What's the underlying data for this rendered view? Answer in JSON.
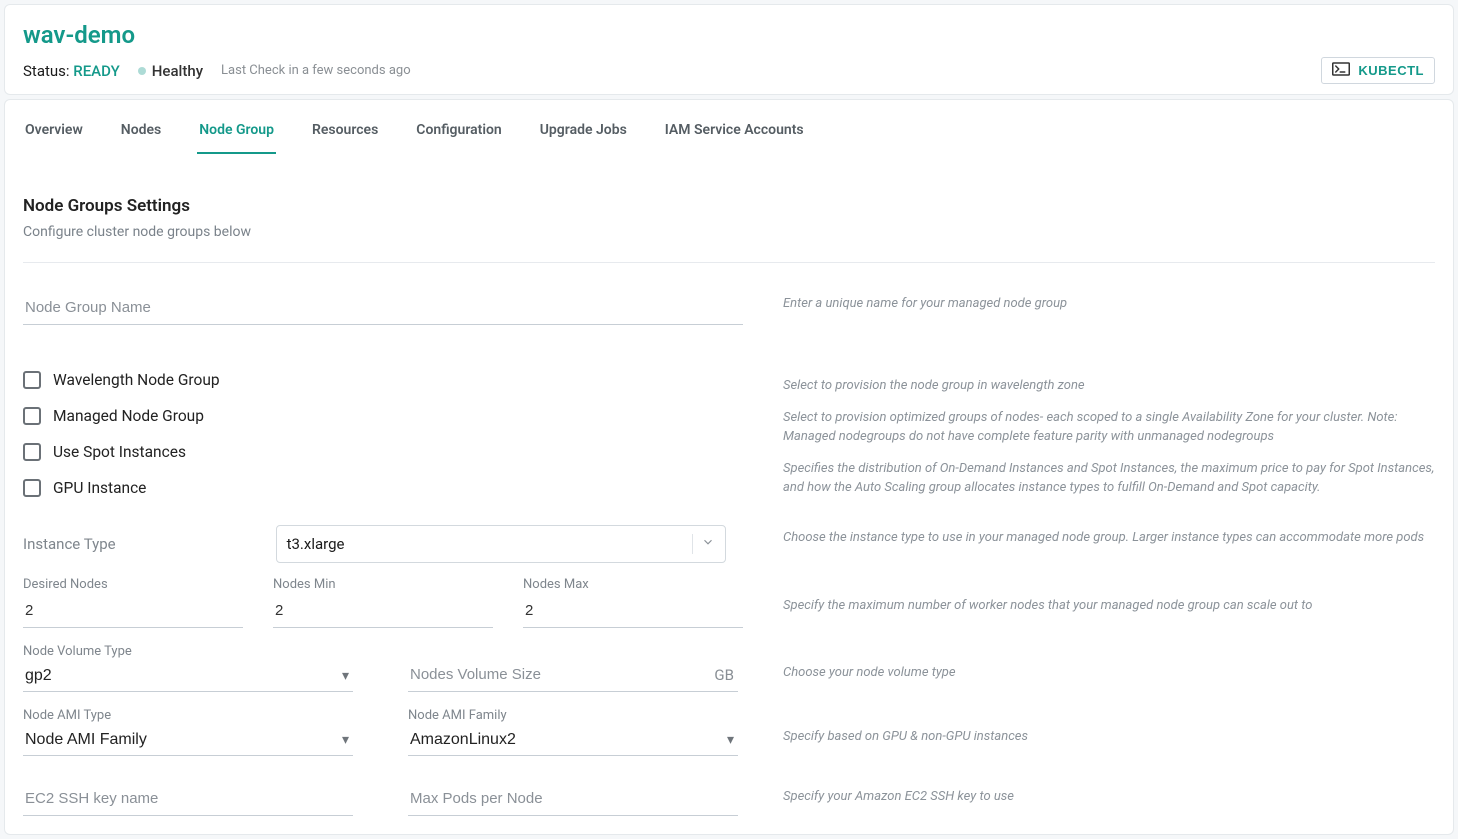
{
  "header": {
    "title": "wav-demo",
    "status_label": "Status:",
    "status_value": "READY",
    "health": "Healthy",
    "last_check": "Last Check in a few seconds ago",
    "kubectl_label": "KUBECTL"
  },
  "tabs": [
    {
      "label": "Overview",
      "active": false
    },
    {
      "label": "Nodes",
      "active": false
    },
    {
      "label": "Node Group",
      "active": true
    },
    {
      "label": "Resources",
      "active": false
    },
    {
      "label": "Configuration",
      "active": false
    },
    {
      "label": "Upgrade Jobs",
      "active": false
    },
    {
      "label": "IAM Service Accounts",
      "active": false
    }
  ],
  "section": {
    "title": "Node Groups Settings",
    "subtitle": "Configure cluster node groups below"
  },
  "fields": {
    "node_group_name": {
      "placeholder": "Node Group Name",
      "hint": "Enter a unique name for your managed node group"
    },
    "wavelength": {
      "label": "Wavelength Node Group",
      "hint": "Select to provision the node group in wavelength zone"
    },
    "managed": {
      "label": "Managed Node Group",
      "hint": "Select to provision optimized groups of nodes- each scoped to a single Availability Zone for your cluster. Note: Managed nodegroups do not have complete feature parity with unmanaged nodegroups"
    },
    "spot": {
      "label": "Use Spot Instances",
      "hint": "Specifies the distribution of On-Demand Instances and Spot Instances, the maximum price to pay for Spot Instances, and how the Auto Scaling group allocates instance types to fulfill On-Demand and Spot capacity."
    },
    "gpu": {
      "label": "GPU Instance"
    },
    "instance_type": {
      "label": "Instance Type",
      "value": "t3.xlarge",
      "hint": "Choose the instance type to use in your managed node group. Larger instance types can accommodate more pods"
    },
    "desired": {
      "label": "Desired Nodes",
      "value": "2"
    },
    "min": {
      "label": "Nodes Min",
      "value": "2"
    },
    "max": {
      "label": "Nodes Max",
      "value": "2"
    },
    "scale_hint": "Specify the maximum number of worker nodes that your managed node group can scale out to",
    "volume_type": {
      "label": "Node Volume Type",
      "value": "gp2"
    },
    "volume_size": {
      "placeholder": "Nodes Volume Size",
      "suffix": "GB"
    },
    "volume_hint": "Choose your node volume type",
    "ami_type": {
      "label": "Node AMI Type",
      "value": "Node AMI Family"
    },
    "ami_family": {
      "label": "Node AMI Family",
      "value": "AmazonLinux2"
    },
    "ami_hint": "Specify based on GPU & non-GPU instances",
    "ssh_key": {
      "placeholder": "EC2 SSH key name"
    },
    "max_pods": {
      "placeholder": "Max Pods per Node"
    },
    "ssh_hint": "Specify your Amazon EC2 SSH key to use"
  }
}
